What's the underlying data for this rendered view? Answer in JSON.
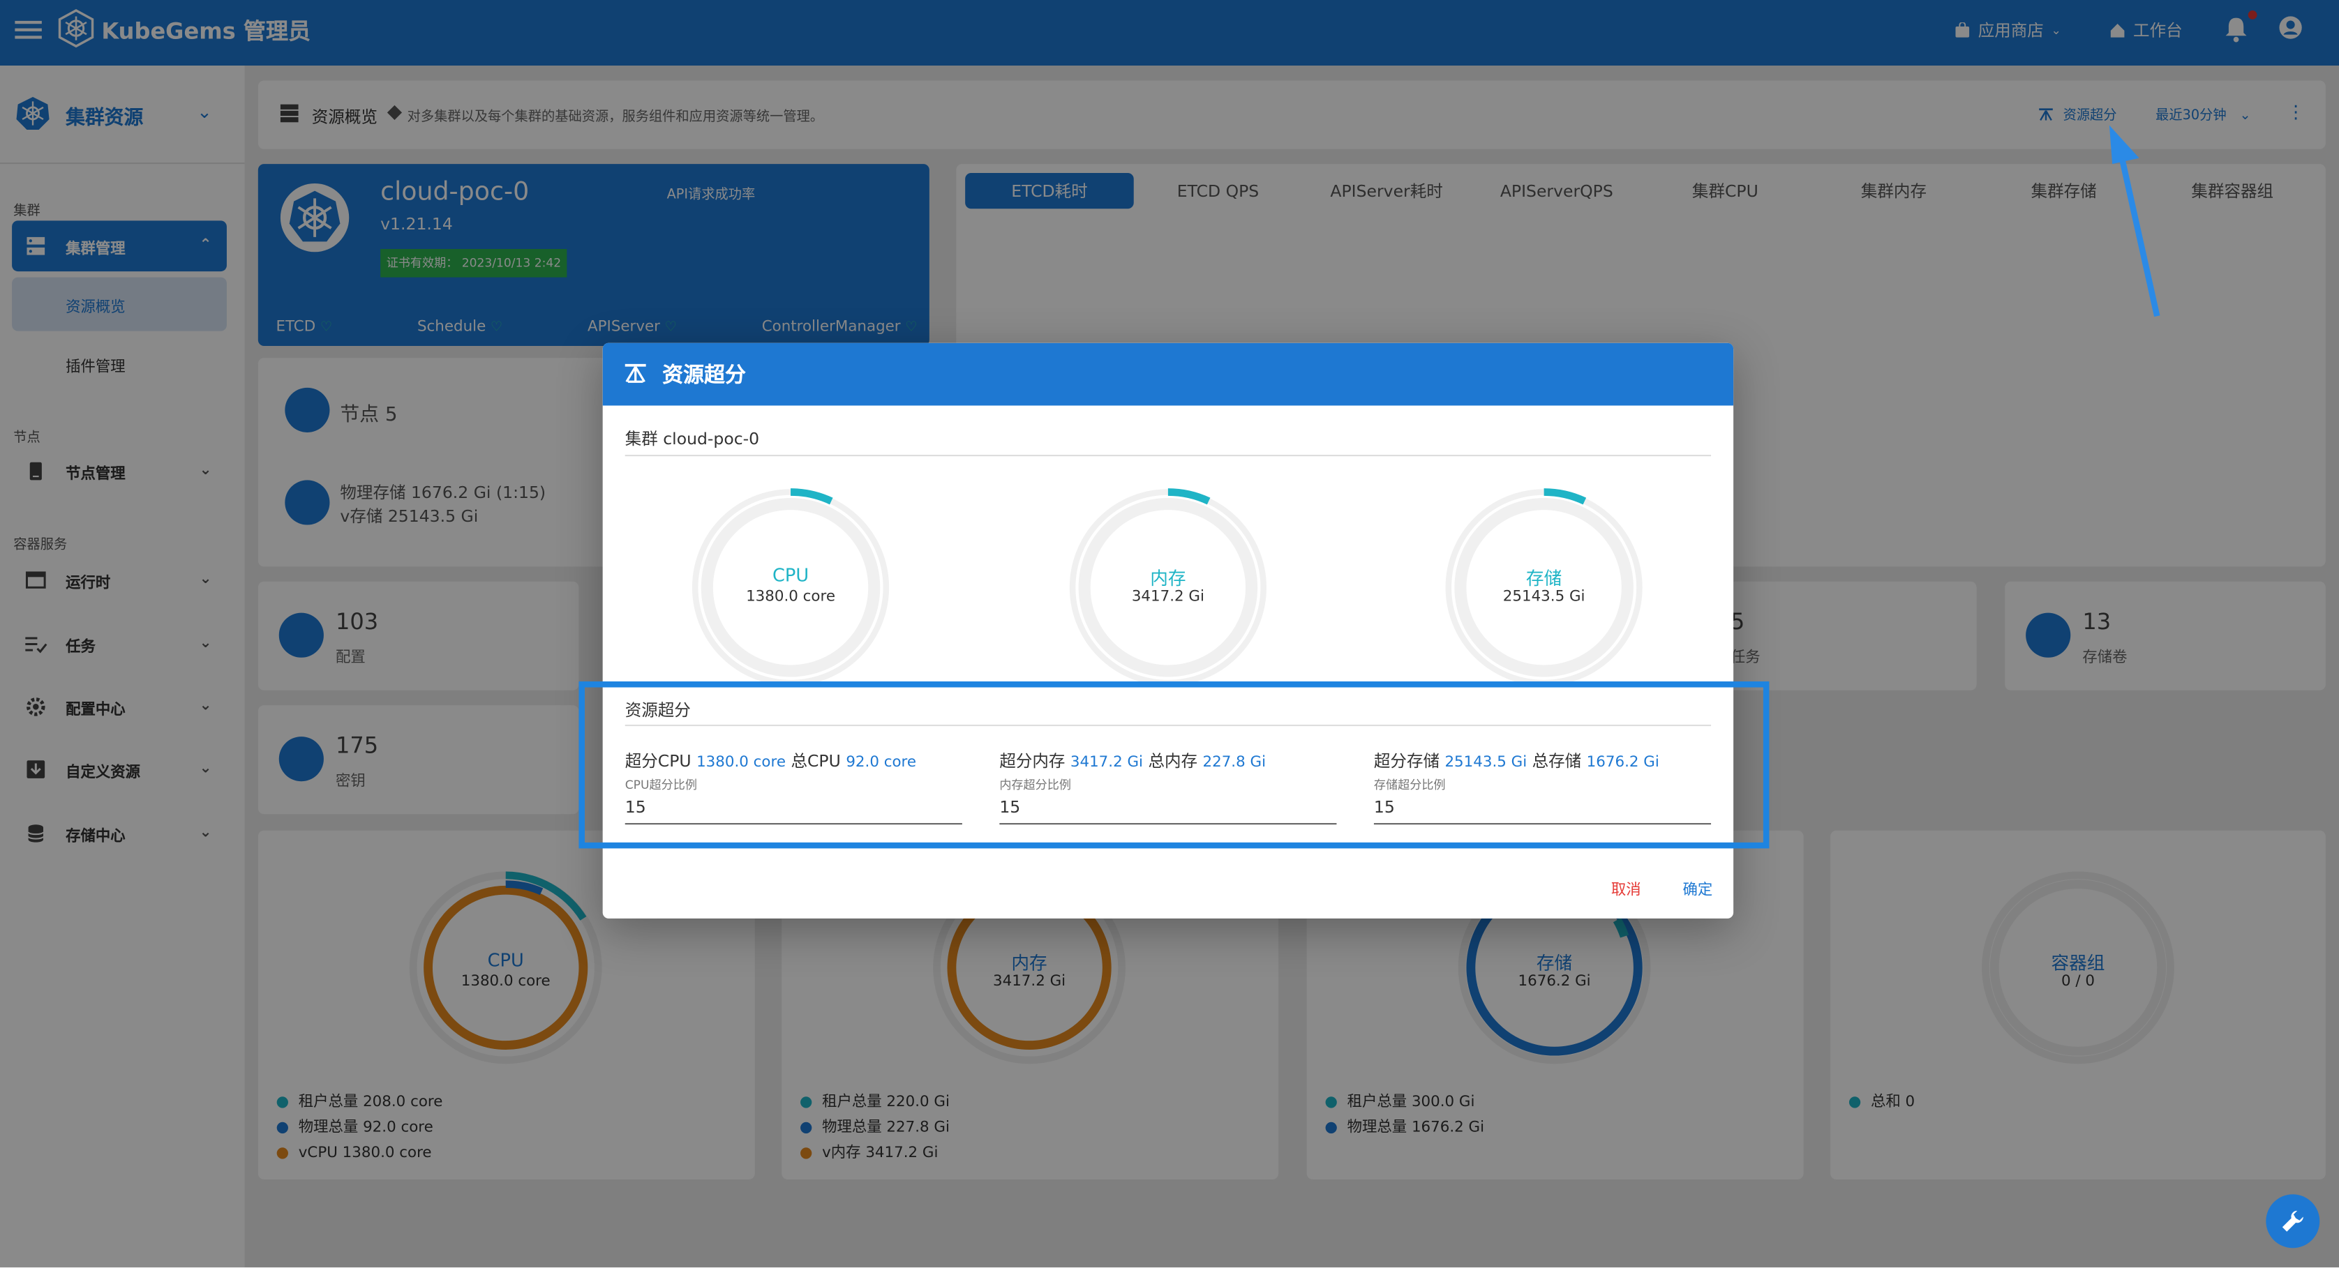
{
  "topbar": {
    "brand": "KubeGems 管理员",
    "app_store": "应用商店",
    "workbench": "工作台"
  },
  "sidebar": {
    "header": "集群资源",
    "cat_cluster": "集群",
    "cluster_mgmt": "集群管理",
    "resource_overview": "资源概览",
    "plugin_mgmt": "插件管理",
    "cat_node": "节点",
    "node_mgmt": "节点管理",
    "cat_container": "容器服务",
    "runtime": "运行时",
    "tasks": "任务",
    "config_center": "配置中心",
    "custom_resources": "自定义资源",
    "storage_center": "存储中心"
  },
  "breadcrumb": {
    "title": "资源概览",
    "desc": "对多集群以及每个集群的基础资源，服务组件和应用资源等统一管理。",
    "overcommit_btn": "资源超分",
    "time_range": "最近30分钟"
  },
  "cluster": {
    "name": "cloud-poc-0",
    "version": "v1.21.14",
    "api_rate": "API请求成功率",
    "cert": "证书有效期：  2023/10/13 2:42",
    "components": [
      "ETCD",
      "Schedule",
      "APIServer",
      "ControllerManager"
    ]
  },
  "tabs": [
    "ETCD耗时",
    "ETCD QPS",
    "APIServer耗时",
    "APIServerQPS",
    "集群CPU",
    "集群内存",
    "集群存储",
    "集群容器组"
  ],
  "stats": {
    "nodes": "节点 5",
    "storage_line1": "物理存储 1676.2 Gi (1:15)",
    "storage_line2": "v存储 25143.5 Gi",
    "config_num": "103",
    "config_label": "配置",
    "task_num": "5",
    "task_label": "任务",
    "volume_num": "13",
    "volume_label": "存储卷",
    "secret_num": "175",
    "secret_label": "密钥"
  },
  "bottom": {
    "cpu": {
      "label": "CPU",
      "value": "1380.0 core",
      "legend": [
        "租户总量 208.0 core",
        "物理总量 92.0 core",
        "vCPU 1380.0 core"
      ]
    },
    "mem": {
      "label": "内存",
      "value": "3417.2 Gi",
      "legend": [
        "租户总量 220.0 Gi",
        "物理总量 227.8 Gi",
        "v内存 3417.2 Gi"
      ]
    },
    "storage": {
      "label": "存储",
      "value": "1676.2 Gi",
      "legend": [
        "租户总量 300.0 Gi",
        "物理总量 1676.2 Gi"
      ]
    },
    "pods": {
      "label": "容器组",
      "value": "0 / 0",
      "legend": [
        "总和 0"
      ]
    }
  },
  "dialog": {
    "title": "资源超分",
    "cluster": "集群 cloud-poc-0",
    "gauges": [
      {
        "label": "CPU",
        "value": "1380.0 core",
        "fraction": 0.07
      },
      {
        "label": "内存",
        "value": "3417.2 Gi",
        "fraction": 0.07
      },
      {
        "label": "存储",
        "value": "25143.5 Gi",
        "fraction": 0.07
      }
    ],
    "section": "资源超分",
    "cpu": {
      "over_label": "超分CPU",
      "over_val": "1380.0 core",
      "total_label": "总CPU",
      "total_val": "92.0 core",
      "caption": "CPU超分比例",
      "ratio": "15"
    },
    "mem": {
      "over_label": "超分内存",
      "over_val": "3417.2 Gi",
      "total_label": "总内存",
      "total_val": "227.8 Gi",
      "caption": "内存超分比例",
      "ratio": "15"
    },
    "sto": {
      "over_label": "超分存储",
      "over_val": "25143.5 Gi",
      "total_label": "总存储",
      "total_val": "1676.2 Gi",
      "caption": "存储超分比例",
      "ratio": "15"
    },
    "cancel": "取消",
    "ok": "确定"
  },
  "colors": {
    "primary": "#1e78d2",
    "cyan": "#1fb4c6",
    "orange": "#e58a1f",
    "danger": "#e53935"
  }
}
